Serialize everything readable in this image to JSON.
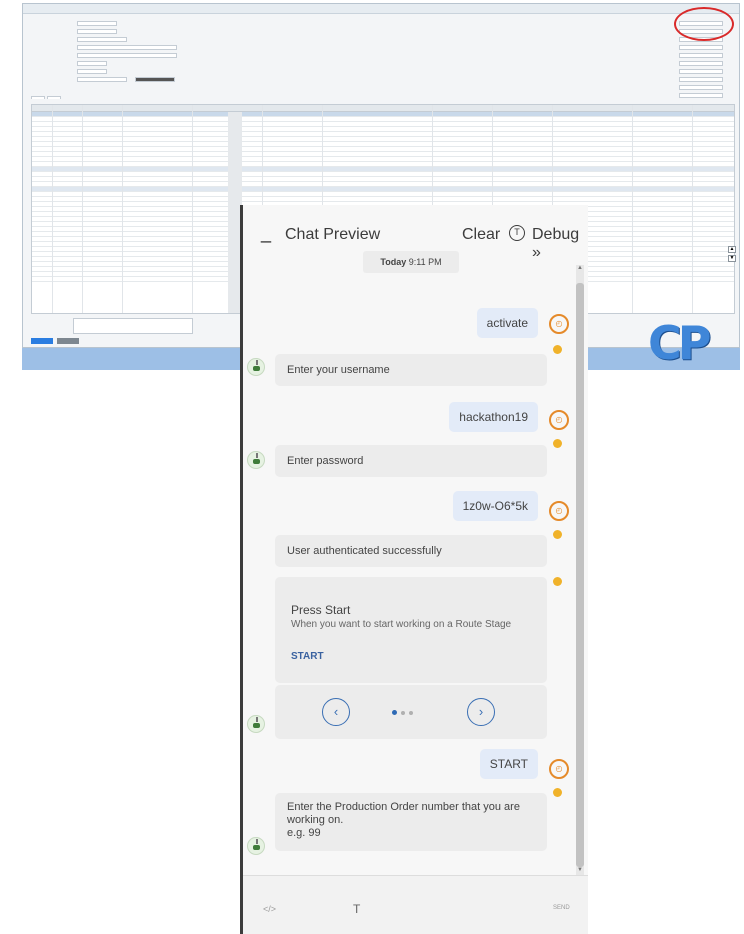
{
  "chat": {
    "title": "Chat Preview",
    "clear_label": "Clear",
    "debug_label": "Debug",
    "debug_icon": "chevrons-right-icon",
    "timestamp_day": "Today",
    "timestamp_time": "9:11 PM",
    "messages": [
      {
        "from": "user",
        "text": "activate"
      },
      {
        "from": "bot",
        "text": "Enter your username"
      },
      {
        "from": "user",
        "text": "hackathon19"
      },
      {
        "from": "bot",
        "text": "Enter password"
      },
      {
        "from": "user",
        "text": "1z0w-O6*5k"
      },
      {
        "from": "bot",
        "text": "User authenticated successfully"
      },
      {
        "from": "user",
        "text": "START"
      },
      {
        "from": "bot",
        "text": "Enter the Production Order number that you are working on.",
        "hint": "e.g. 99"
      }
    ],
    "card": {
      "title": "Press Start",
      "subtitle": "When you want to start working on a Route Stage",
      "button_label": "START"
    },
    "carousel": {
      "prev": "‹",
      "next": "›"
    },
    "input": {
      "placeholder": "</>",
      "type_icon": "T",
      "send_label": "SEND"
    }
  },
  "erp": {
    "logo_text": "CP",
    "colors": {
      "accent": "#2a7de1",
      "highlight_circle": "#d92a2a",
      "footer": "#9dbfe6"
    }
  }
}
